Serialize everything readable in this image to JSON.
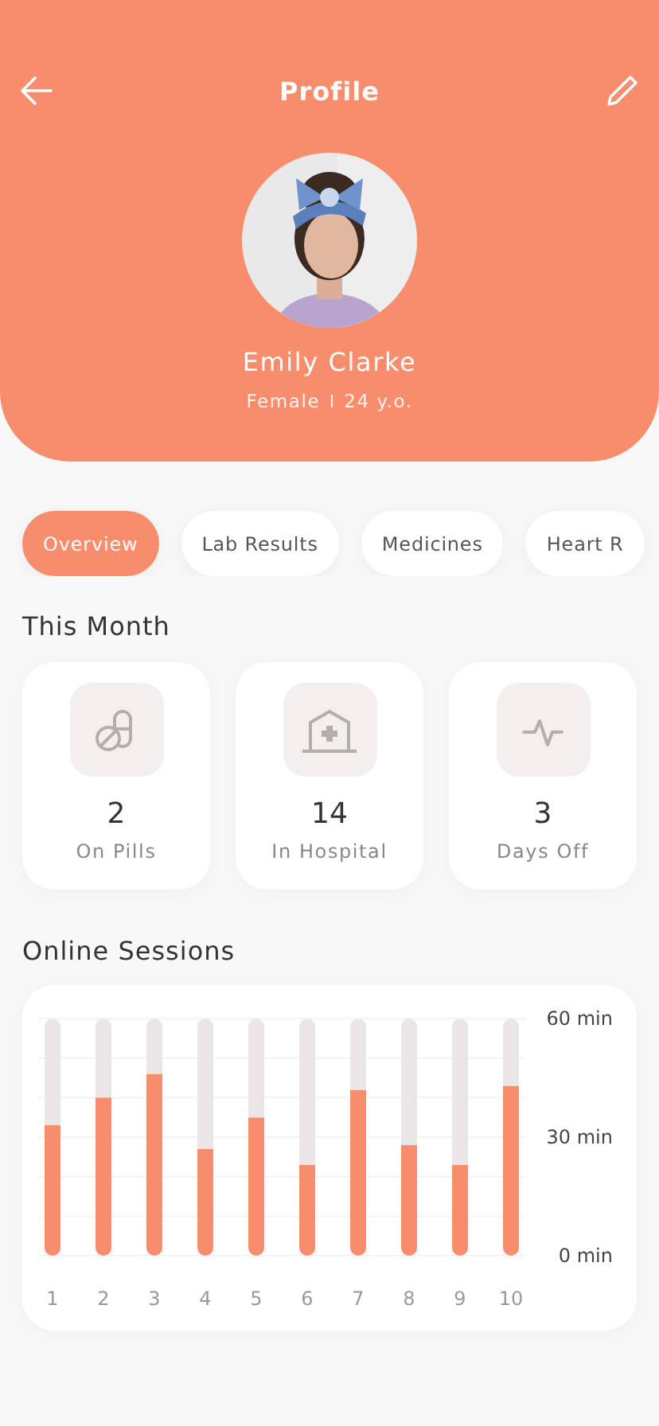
{
  "header": {
    "title": "Profile",
    "name": "Emily Clarke",
    "gender": "Female",
    "age": "24 y.o."
  },
  "tabs": [
    {
      "label": "Overview",
      "selected": true
    },
    {
      "label": "Lab Results",
      "selected": false
    },
    {
      "label": "Medicines",
      "selected": false
    },
    {
      "label": "Heart R",
      "selected": false
    }
  ],
  "this_month": {
    "title": "This Month",
    "stats": [
      {
        "value": "2",
        "label": "On Pills"
      },
      {
        "value": "14",
        "label": "In Hospital"
      },
      {
        "value": "3",
        "label": "Days Off"
      }
    ]
  },
  "online_sessions": {
    "title": "Online Sessions",
    "chart_data": {
      "type": "bar",
      "categories": [
        "1",
        "2",
        "3",
        "4",
        "5",
        "6",
        "7",
        "8",
        "9",
        "10"
      ],
      "stacked": true,
      "series": [
        {
          "color": "#f88d6d",
          "values": [
            33,
            40,
            46,
            27,
            35,
            23,
            42,
            28,
            23,
            43
          ]
        },
        {
          "color": "#eae6e5",
          "values": [
            27,
            20,
            14,
            33,
            25,
            37,
            18,
            32,
            37,
            17
          ]
        }
      ],
      "ylim": [
        0,
        60
      ],
      "yticks": [
        {
          "value": 0,
          "label": "0 min"
        },
        {
          "value": 30,
          "label": "30 min"
        },
        {
          "value": 60,
          "label": "60 min"
        }
      ]
    }
  }
}
